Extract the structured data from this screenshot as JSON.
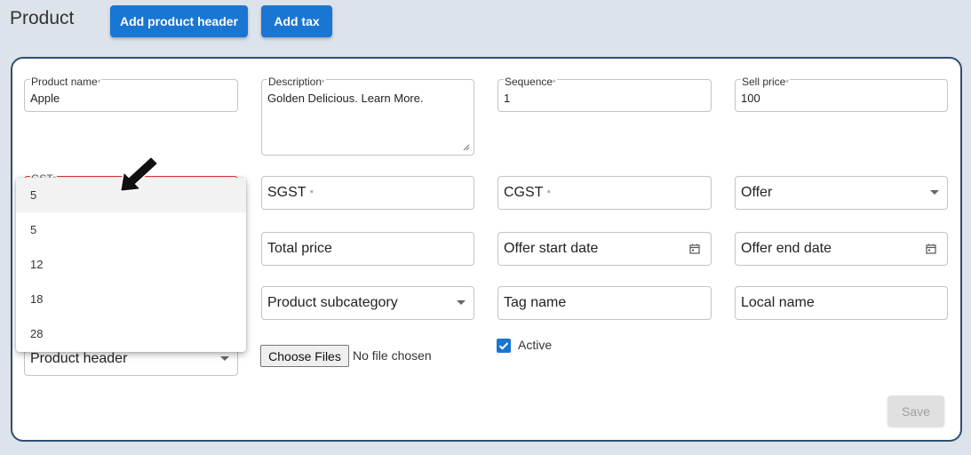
{
  "page": {
    "title": "Product"
  },
  "toolbar": {
    "add_header_label": "Add product header",
    "add_tax_label": "Add tax"
  },
  "form": {
    "product_name": {
      "label": "Product name",
      "required_mark": "*",
      "value": "Apple"
    },
    "description": {
      "label": "Description",
      "required_mark": "*",
      "value": "Golden Delicious. Learn More."
    },
    "sequence": {
      "label": "Sequence",
      "required_mark": "*",
      "value": "1"
    },
    "sell_price": {
      "label": "Sell price",
      "required_mark": "*",
      "value": "100"
    },
    "gst": {
      "label": "GST",
      "required_mark": "*"
    },
    "sgst": {
      "placeholder": "SGST",
      "required_mark": "*"
    },
    "cgst": {
      "placeholder": "CGST",
      "required_mark": "*"
    },
    "offer": {
      "placeholder": "Offer"
    },
    "total_price": {
      "placeholder": "Total price"
    },
    "offer_start_date": {
      "placeholder": "Offer start date"
    },
    "offer_end_date": {
      "placeholder": "Offer end date"
    },
    "product_subcategory": {
      "placeholder": "Product subcategory"
    },
    "tag_name": {
      "placeholder": "Tag name"
    },
    "local_name": {
      "placeholder": "Local name"
    },
    "product_header": {
      "placeholder": "Product header"
    },
    "file": {
      "button_label": "Choose Files",
      "status": "No file chosen"
    },
    "active": {
      "label": "Active",
      "checked": true
    },
    "save_label": "Save"
  },
  "gst_dropdown": {
    "options": [
      "5",
      "5",
      "12",
      "18",
      "28"
    ],
    "highlighted_index": 0
  },
  "colors": {
    "primary": "#1976d2",
    "error": "#e53935",
    "card_border": "#2f4f6f",
    "background": "#dde3ea"
  },
  "icons": {
    "calendar": "calendar-icon",
    "caret": "chevron-down-icon",
    "cursor": "arrow-cursor-icon"
  }
}
